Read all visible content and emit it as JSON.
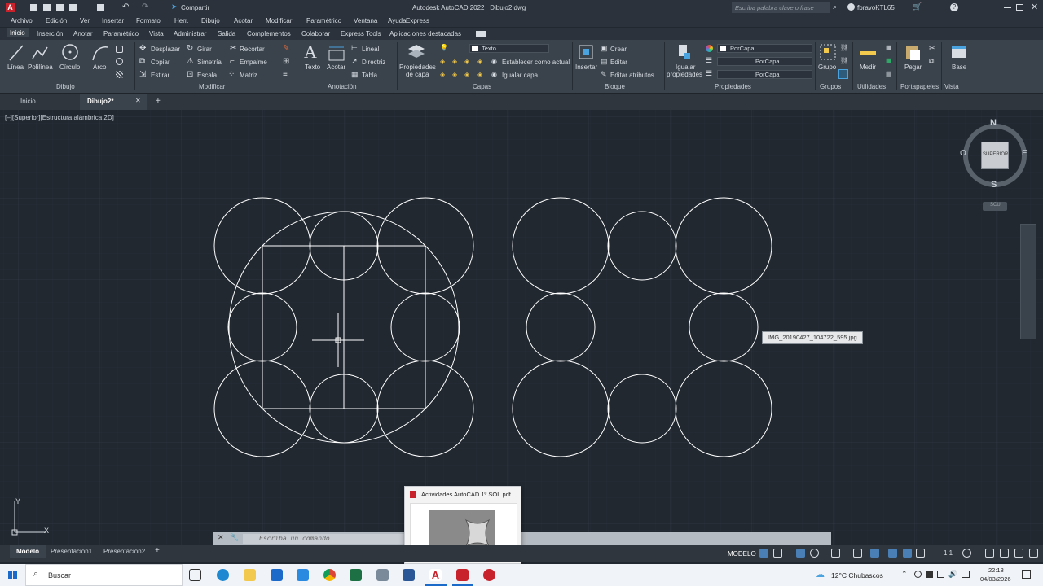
{
  "title_bar": {
    "app_title": "Autodesk AutoCAD 2022",
    "file_name": "Dibujo2.dwg",
    "share_label": "Compartir",
    "search_placeholder": "Escriba palabra clave o frase",
    "user_name": "fbravoKTL65"
  },
  "menu_bar": {
    "items": [
      "Archivo",
      "Edición",
      "Ver",
      "Insertar",
      "Formato",
      "Herr.",
      "Dibujo",
      "Acotar",
      "Modificar",
      "Paramétrico",
      "Ventana",
      "Ayuda",
      "Express"
    ]
  },
  "ribbon_tabs": {
    "items": [
      "Inicio",
      "Inserción",
      "Anotar",
      "Paramétrico",
      "Vista",
      "Administrar",
      "Salida",
      "Complementos",
      "Colaborar",
      "Express Tools",
      "Aplicaciones destacadas"
    ],
    "active": "Inicio"
  },
  "ribbon": {
    "draw": {
      "title": "Dibujo",
      "line": "Línea",
      "polyline": "Polilínea",
      "circle": "Círculo",
      "arc": "Arco"
    },
    "modify": {
      "title": "Modificar",
      "move": "Desplazar",
      "rotate": "Girar",
      "trim": "Recortar",
      "copy": "Copiar",
      "mirror": "Simetría",
      "fillet": "Empalme",
      "stretch": "Estirar",
      "scale": "Escala",
      "array": "Matriz"
    },
    "annotation": {
      "title": "Anotación",
      "text": "Texto",
      "dimension": "Acotar",
      "linear": "Lineal",
      "leader": "Directriz",
      "table": "Tabla"
    },
    "layers": {
      "title": "Capas",
      "layer_props_line1": "Propiedades",
      "layer_props_line2": "de capa",
      "current_layer": "Texto",
      "set_current": "Establecer como actual",
      "match_layer": "Igualar capa"
    },
    "block": {
      "title": "Bloque",
      "insert": "Insertar",
      "create": "Crear",
      "edit": "Editar",
      "edit_attributes": "Editar atributos"
    },
    "properties": {
      "title": "Propiedades",
      "match_line1": "Igualar",
      "match_line2": "propiedades",
      "color": "PorCapa",
      "linetype": "PorCapa",
      "lineweight": "PorCapa"
    },
    "groups": {
      "title": "Grupos",
      "group": "Grupo"
    },
    "utilities": {
      "title": "Utilidades",
      "measure": "Medir"
    },
    "clipboard": {
      "title": "Portapapeles",
      "paste": "Pegar"
    },
    "view": {
      "title": "Vista",
      "base": "Base"
    }
  },
  "doc_tabs": {
    "home": "Inicio",
    "active": "Dibujo2*"
  },
  "viewport": {
    "label": "[–][Superior][Estructura alámbrica 2D]",
    "viewcube": {
      "north": "N",
      "south": "S",
      "east": "E",
      "west": "O",
      "face": "SUPERIOR",
      "wcs": "SCU"
    },
    "tooltip": "IMG_20190427_104722_595.jpg",
    "ucs": {
      "x": "X",
      "y": "Y"
    }
  },
  "command_line": {
    "placeholder": "Escriba un comando"
  },
  "thumbnail_popup": {
    "title": "Actividades AutoCAD 1º SOL.pdf"
  },
  "layout_tabs": {
    "items": [
      "Modelo",
      "Presentación1",
      "Presentación2"
    ],
    "active": "Modelo"
  },
  "status_bar": {
    "model": "MODELO",
    "scale": "1:1"
  },
  "taskbar": {
    "search": "Buscar",
    "weather": "12°C  Chubascos",
    "time": "22:18",
    "date": "04/03/2026"
  },
  "colors": {
    "canvas": "#212830",
    "ribbon": "#3a424b",
    "geometry": "#ffffff",
    "taskbar": "#f0f3f7"
  }
}
